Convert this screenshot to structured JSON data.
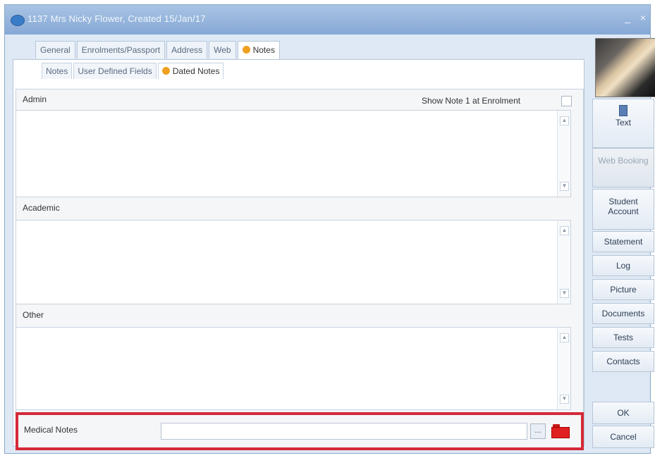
{
  "window": {
    "title": "1137 Mrs Nicky Flower, Created 15/Jan/17",
    "controls": [
      "_",
      "×"
    ]
  },
  "tabs": [
    {
      "label": "General",
      "active": false
    },
    {
      "label": "Enrolments/Passport",
      "active": false
    },
    {
      "label": "Address",
      "active": false
    },
    {
      "label": "Web",
      "active": false
    },
    {
      "label": "Notes",
      "active": true,
      "icon": "bulb-icon"
    }
  ],
  "subtabs": [
    {
      "label": "Notes",
      "active": false
    },
    {
      "label": "User Defined Fields",
      "active": false
    },
    {
      "label": "Dated Notes",
      "active": true,
      "icon": "bulb-icon"
    }
  ],
  "notes": {
    "admin_label": "Admin",
    "admin_value": "",
    "show_note_label": "Show Note 1 at Enrolment",
    "show_note_checked": false,
    "academic_label": "Academic",
    "academic_value": "",
    "other_label": "Other",
    "other_value": "",
    "medical_label": "Medical Notes",
    "medical_value": "",
    "browse_button": "..."
  },
  "sidebar": {
    "text_button": "Text",
    "web_booking": "Web Booking",
    "student_account": "Student Account",
    "statement": "Statement",
    "log": "Log",
    "picture": "Picture",
    "documents": "Documents",
    "tests": "Tests",
    "contacts": "Contacts",
    "ok": "OK",
    "cancel": "Cancel"
  },
  "colors": {
    "titlebar": "#8fb0da",
    "highlight_border": "#d42a3a",
    "folder_red": "#e02020"
  }
}
